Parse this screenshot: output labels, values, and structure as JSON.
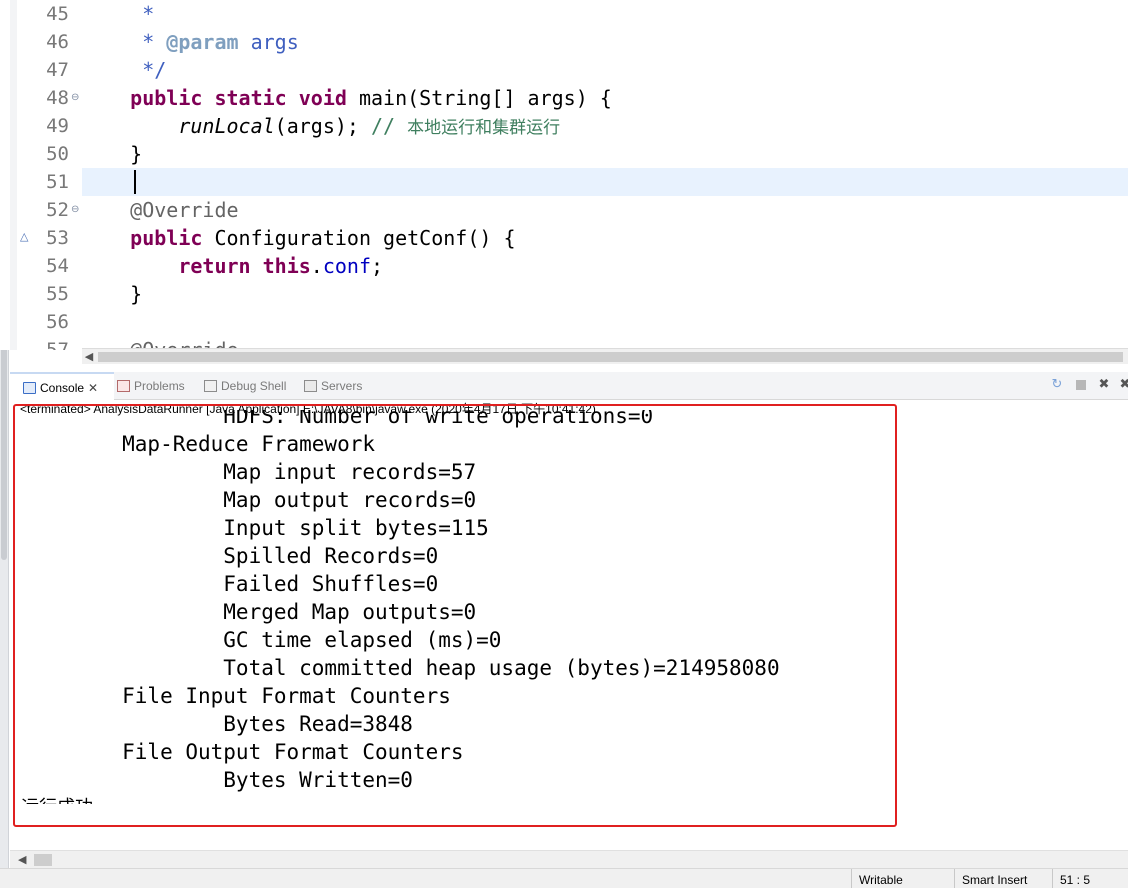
{
  "editor": {
    "lines": [
      {
        "no": "45",
        "segments": [
          {
            "text": "     *",
            "cls": "jd"
          }
        ]
      },
      {
        "no": "46",
        "segments": [
          {
            "text": "     * ",
            "cls": "jd"
          },
          {
            "text": "@param",
            "cls": "jdtag"
          },
          {
            "text": " args",
            "cls": "jd"
          }
        ]
      },
      {
        "no": "47",
        "segments": [
          {
            "text": "     */",
            "cls": "jd"
          }
        ]
      },
      {
        "no": "48",
        "fold": true,
        "segments": [
          {
            "text": "    "
          },
          {
            "text": "public",
            "cls": "kw"
          },
          {
            "text": " "
          },
          {
            "text": "static",
            "cls": "kw"
          },
          {
            "text": " "
          },
          {
            "text": "void",
            "cls": "kw"
          },
          {
            "text": " main(String[] args) {"
          }
        ]
      },
      {
        "no": "49",
        "segments": [
          {
            "text": "        "
          },
          {
            "text": "runLocal",
            "cls": "it"
          },
          {
            "text": "(args); "
          },
          {
            "text": "// ",
            "cls": "cm"
          },
          {
            "text": "本地运行和集群运行",
            "cls": "cm-cn"
          }
        ]
      },
      {
        "no": "50",
        "segments": [
          {
            "text": "    }"
          }
        ]
      },
      {
        "no": "51",
        "segments": [
          {
            "text": ""
          }
        ]
      },
      {
        "no": "52",
        "fold": true,
        "segments": [
          {
            "text": "    "
          },
          {
            "text": "@Override",
            "cls": "ann"
          }
        ]
      },
      {
        "no": "53",
        "override_marker": true,
        "segments": [
          {
            "text": "    "
          },
          {
            "text": "public",
            "cls": "kw"
          },
          {
            "text": " Configuration getConf() {"
          }
        ]
      },
      {
        "no": "54",
        "segments": [
          {
            "text": "        "
          },
          {
            "text": "return",
            "cls": "kw"
          },
          {
            "text": " "
          },
          {
            "text": "this",
            "cls": "kw"
          },
          {
            "text": "."
          },
          {
            "text": "conf",
            "cls": "fld"
          },
          {
            "text": ";"
          }
        ]
      },
      {
        "no": "55",
        "segments": [
          {
            "text": "    }"
          }
        ]
      },
      {
        "no": "56",
        "segments": [
          {
            "text": ""
          }
        ]
      },
      {
        "no": "57",
        "segments": [
          {
            "text": "    "
          },
          {
            "text": "@Override",
            "cls": "ann"
          }
        ]
      }
    ],
    "current_line": "51",
    "fold_icon": "fold-minus-icon",
    "override_icon": "override-triangle-icon"
  },
  "views": {
    "tabs": [
      {
        "id": "console",
        "label": "Console",
        "icon": "console-icon",
        "active": true,
        "close": "✕"
      },
      {
        "id": "problems",
        "label": "Problems",
        "icon": "problems-icon"
      },
      {
        "id": "debug",
        "label": "Debug Shell",
        "icon": "debug-shell-icon"
      },
      {
        "id": "servers",
        "label": "Servers",
        "icon": "servers-icon"
      }
    ],
    "toolbar_icons": [
      "pin-console-icon",
      "terminate-icon",
      "remove-launch-icon",
      "remove-all-terminated-icon"
    ]
  },
  "console": {
    "header": "<terminated> AnalysisDataRunner [Java Application] E:\\JAVA8\\bin\\javaw.exe (2020年4月17日 下午10:41:42)",
    "partial_line": "                HDFS: Number of write operations=0",
    "output": [
      "        Map-Reduce Framework",
      "                Map input records=57",
      "                Map output records=0",
      "                Input split bytes=115",
      "                Spilled Records=0",
      "                Failed Shuffles=0",
      "                Merged Map outputs=0",
      "                GC time elapsed (ms)=0",
      "                Total committed heap usage (bytes)=214958080",
      "        File Input Format Counters",
      "                Bytes Read=3848",
      "        File Output Format Counters",
      "                Bytes Written=0"
    ],
    "success": "运行成功"
  },
  "status": {
    "writable": "Writable",
    "insert_mode": "Smart Insert",
    "position": "51 : 5"
  },
  "colors": {
    "highlight_box": "#e02020",
    "current_line": "#e8f2fe"
  }
}
